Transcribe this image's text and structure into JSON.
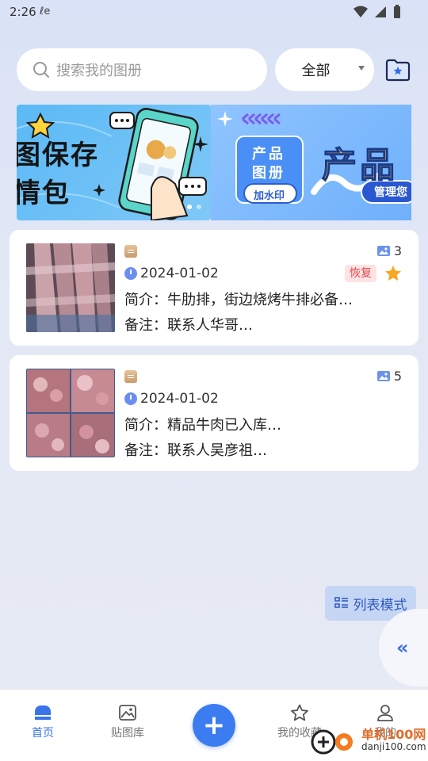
{
  "status_bar": {
    "time": "2:26",
    "carrier_glyph": "ℓe"
  },
  "search": {
    "placeholder": "搜索我的图册"
  },
  "filter": {
    "selected": "全部"
  },
  "banner": {
    "slide1": {
      "line1": "图保存",
      "line2": "情包"
    },
    "slide2": {
      "card_line1": "产品",
      "card_line2": "图册",
      "card_pill": "加水印",
      "title": "产品",
      "bottom_pill": "管理您"
    }
  },
  "albums": [
    {
      "date": "2024-01-02",
      "image_count": "3",
      "intro": "简介：牛肋排，街边烧烤牛排必备…",
      "remark": "备注：联系人华哥…",
      "restore_label": "恢复",
      "starred": true
    },
    {
      "date": "2024-01-02",
      "image_count": "5",
      "intro": "简介：精品牛肉已入库…",
      "remark": "备注：联系人吴彦祖…"
    }
  ],
  "list_mode_label": "列表模式",
  "collapse_glyph": "«",
  "nav": {
    "home": "首页",
    "gallery": "贴图库",
    "add": "+",
    "favorites": "我的收藏",
    "mine": "我的"
  },
  "watermark": {
    "name": "单机100网",
    "url": "danji100.com"
  },
  "colors": {
    "accent": "#3a74e8",
    "restore": "#e0494d",
    "star": "#f5a623"
  }
}
